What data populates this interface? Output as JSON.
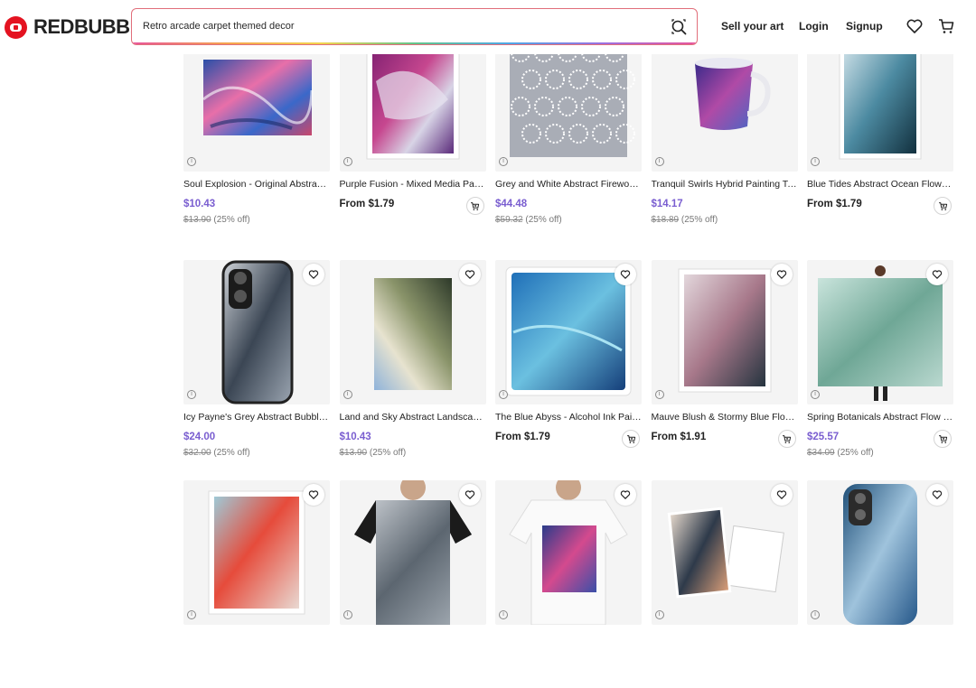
{
  "header": {
    "brand": "REDBUBBLE",
    "search_value": "Retro arcade carpet themed decor",
    "nav": {
      "sell": "Sell your art",
      "login": "Login",
      "signup": "Signup"
    }
  },
  "colors": {
    "brand": "#e41321",
    "price": "#7a5ed0"
  },
  "products": [
    {
      "title": "Soul Explosion - Original Abstract Ink Painting",
      "price": "$10.43",
      "original": "$13.90",
      "discount": "(25% off)",
      "cart": false,
      "image": "sticker-ink"
    },
    {
      "title": "Purple Fusion - Mixed Media Painting",
      "price": "From $1.79",
      "original": "",
      "discount": "",
      "cart": true,
      "image": "print-purple"
    },
    {
      "title": "Grey and White Abstract Fireworks",
      "price": "$44.48",
      "original": "$59.32",
      "discount": "(25% off)",
      "cart": false,
      "image": "pattern-grey"
    },
    {
      "title": "Tranquil Swirls Hybrid Painting Tall Mug",
      "price": "$14.17",
      "original": "$18.89",
      "discount": "(25% off)",
      "cart": false,
      "image": "mug"
    },
    {
      "title": "Blue Tides Abstract Ocean Flow Painting",
      "price": "From $1.79",
      "original": "",
      "discount": "",
      "cart": true,
      "image": "print-blue"
    },
    {
      "title": "Icy Payne's Grey Abstract Bubble Painting",
      "price": "$24.00",
      "original": "$32.00",
      "discount": "(25% off)",
      "cart": false,
      "image": "phone-case-grey"
    },
    {
      "title": "Land and Sky Abstract Landscape Painting",
      "price": "$10.43",
      "original": "$13.90",
      "discount": "(25% off)",
      "cart": false,
      "image": "print-land"
    },
    {
      "title": "The Blue Abyss - Alcohol Ink Painting",
      "price": "From $1.79",
      "original": "",
      "discount": "",
      "cart": true,
      "image": "sticker-blue"
    },
    {
      "title": "Mauve Blush & Stormy Blue Flow Painting",
      "price": "From $1.91",
      "original": "",
      "discount": "",
      "cart": true,
      "image": "print-mauve"
    },
    {
      "title": "Spring Botanicals Abstract Flow Painting",
      "price": "$25.57",
      "original": "$34.09",
      "discount": "(25% off)",
      "cart": true,
      "image": "scarf"
    },
    {
      "title": "",
      "price": "",
      "original": "",
      "discount": "",
      "cart": false,
      "image": "print-red"
    },
    {
      "title": "",
      "price": "",
      "original": "",
      "discount": "",
      "cart": false,
      "image": "tshirt-grey"
    },
    {
      "title": "",
      "price": "",
      "original": "",
      "discount": "",
      "cart": false,
      "image": "tshirt-white"
    },
    {
      "title": "",
      "price": "",
      "original": "",
      "discount": "",
      "cart": false,
      "image": "postcard"
    },
    {
      "title": "",
      "price": "",
      "original": "",
      "discount": "",
      "cart": false,
      "image": "phone-case-blue"
    }
  ]
}
